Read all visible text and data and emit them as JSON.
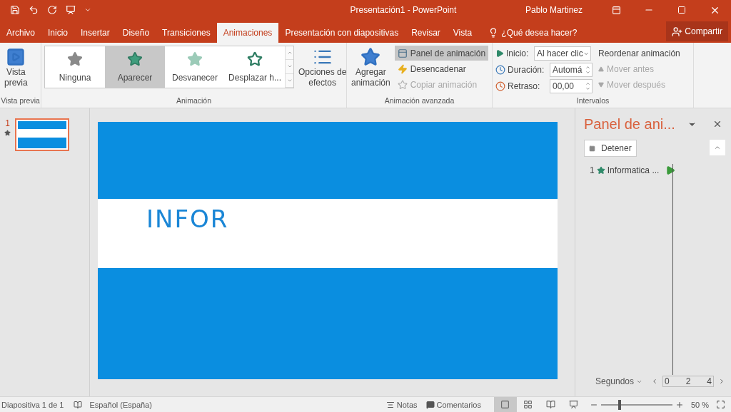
{
  "title_bar": {
    "title": "Presentación1  -  PowerPoint",
    "user": "Pablo Martinez"
  },
  "tabs": [
    {
      "label": "Archivo",
      "selected": false
    },
    {
      "label": "Inicio",
      "selected": false
    },
    {
      "label": "Insertar",
      "selected": false
    },
    {
      "label": "Diseño",
      "selected": false
    },
    {
      "label": "Transiciones",
      "selected": false
    },
    {
      "label": "Animaciones",
      "selected": true
    },
    {
      "label": "Presentación con diapositivas",
      "selected": false
    },
    {
      "label": "Revisar",
      "selected": false
    },
    {
      "label": "Vista",
      "selected": false
    }
  ],
  "tell_me": "¿Qué desea hacer?",
  "share": "Compartir",
  "ribbon": {
    "preview": {
      "label_lines": [
        "Vista",
        "previa"
      ],
      "group": "Vista previa"
    },
    "animation": {
      "items": [
        {
          "label": "Ninguna",
          "kind": "none",
          "selected": false
        },
        {
          "label": "Aparecer",
          "kind": "appear",
          "selected": true
        },
        {
          "label": "Desvanecer",
          "kind": "fade",
          "selected": false
        },
        {
          "label": "Desplazar h...",
          "kind": "fly",
          "selected": false
        }
      ],
      "effects_lines": [
        "Opciones de",
        "efectos"
      ],
      "group": "Animación"
    },
    "advanced": {
      "add_lines": [
        "Agregar",
        "animación"
      ],
      "items": [
        {
          "label": "Panel de animación",
          "kind": "pane",
          "selected": true,
          "disabled": false
        },
        {
          "label": "Desencadenar",
          "kind": "trigger",
          "selected": false,
          "disabled": false
        },
        {
          "label": "Copiar animación",
          "kind": "copy",
          "selected": false,
          "disabled": true
        }
      ],
      "group": "Animación avanzada"
    },
    "timing": {
      "fields": [
        {
          "label": "Inicio:",
          "value": "Al hacer clic",
          "kind": "dropdown"
        },
        {
          "label": "Duración:",
          "value": "Automá",
          "kind": "spinner"
        },
        {
          "label": "Retraso:",
          "value": "00,00",
          "kind": "spinner"
        }
      ],
      "reorder": "Reordenar animación",
      "moves": [
        {
          "label": "Mover antes",
          "kind": "up",
          "disabled": true
        },
        {
          "label": "Mover después",
          "kind": "down",
          "disabled": true
        }
      ],
      "group": "Intervalos"
    }
  },
  "thumbnails": [
    {
      "number": "1",
      "selected": true
    }
  ],
  "slide": {
    "title": "INFOR"
  },
  "animation_pane": {
    "title": "Panel de ani...",
    "stop": "Detener",
    "items": [
      {
        "number": "1",
        "label": "Informatica ..."
      }
    ],
    "seconds": "Segundos",
    "ticks": [
      "0",
      "2",
      "4"
    ]
  },
  "status_bar": {
    "slide": "Diapositiva 1 de 1",
    "language": "Español (España)",
    "notes": "Notas",
    "comments": "Comentarios",
    "views": [
      {
        "kind": "normal",
        "selected": true
      },
      {
        "kind": "sorter",
        "selected": false
      },
      {
        "kind": "reading",
        "selected": false
      },
      {
        "kind": "show",
        "selected": false
      }
    ],
    "zoom": {
      "level": 0.26,
      "label": "50 %"
    }
  }
}
